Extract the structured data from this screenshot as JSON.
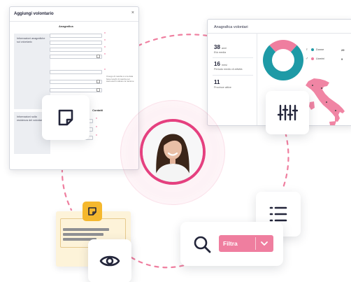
{
  "form": {
    "title": "Aggiungi volontario",
    "close_symbol": "×",
    "section_heading": "Anagrafica",
    "section2_heading": "Contatti",
    "side_label_1": "Informazioni anagrafiche sul volontario",
    "side_label_2": "Informazioni sulla residenza del volontario",
    "helper_text": "Il luogo di nascita è una data base luoghi di nascita per stati esteri indicare la nazione",
    "required_symbol": "*"
  },
  "dashboard": {
    "title": "Anagrafica volontari",
    "stats": [
      {
        "value": "38",
        "unit": "anni",
        "label": "Età media"
      },
      {
        "value": "16",
        "unit": "mesi",
        "label": "Periodo medio di attività"
      },
      {
        "value": "11",
        "unit": "",
        "label": "Province attive"
      }
    ],
    "legend": [
      {
        "gender_icon": "♀",
        "label": "Donne",
        "value": "29",
        "color": "#1e9aa6"
      },
      {
        "gender_icon": "♂",
        "label": "Uomini",
        "value": "9",
        "color": "#ef7e9f"
      }
    ]
  },
  "chart_data": {
    "type": "pie",
    "categories": [
      "Donne",
      "Uomini"
    ],
    "values": [
      29,
      9
    ],
    "colors": [
      "#1e9aa6",
      "#ef7e9f"
    ]
  },
  "filter": {
    "label": "Filtra"
  },
  "icons": {
    "note": "note-icon",
    "sliders": "sliders-icon",
    "list": "list-icon",
    "search": "search-icon",
    "eye": "eye-icon",
    "chevron": "chevron-down-icon",
    "doc_badge": "note-badge-icon"
  },
  "colors": {
    "accent": "#e5407f",
    "teal": "#1e9aa6",
    "pink_light": "#ef7e9f",
    "badge_yellow": "#f5b82e"
  }
}
